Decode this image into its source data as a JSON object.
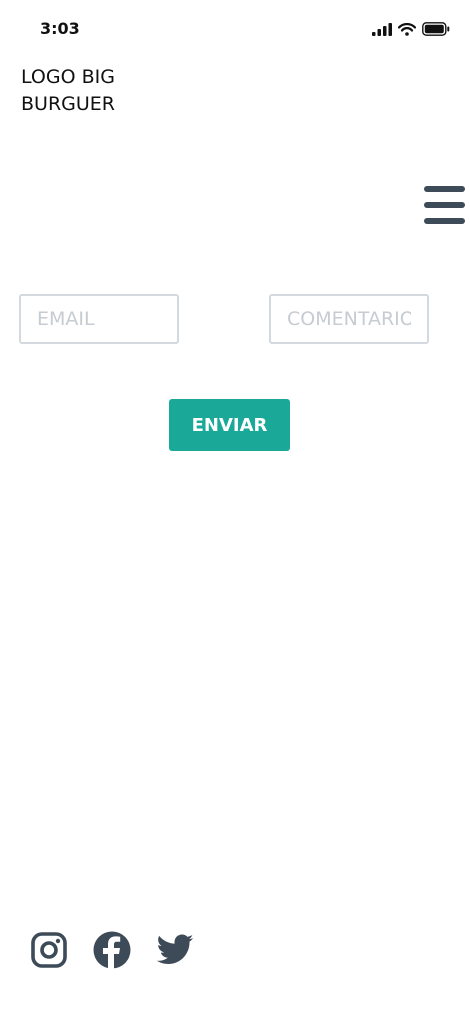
{
  "status_bar": {
    "time": "3:03",
    "icons": [
      "signal-icon",
      "wifi-icon",
      "battery-icon"
    ]
  },
  "header": {
    "logo_text": "LOGO BIG BURGUER",
    "menu_icon": "hamburger-menu-icon"
  },
  "form": {
    "email_placeholder": "EMAIL",
    "comment_placeholder": "COMENTARIO",
    "send_label": "ENVIAR"
  },
  "footer": {
    "social": [
      "instagram-icon",
      "facebook-icon",
      "twitter-icon"
    ]
  },
  "colors": {
    "accent": "#1aa999",
    "icon": "#3d4a57",
    "input_border": "#d4d9df",
    "placeholder": "#c7ccd2"
  }
}
